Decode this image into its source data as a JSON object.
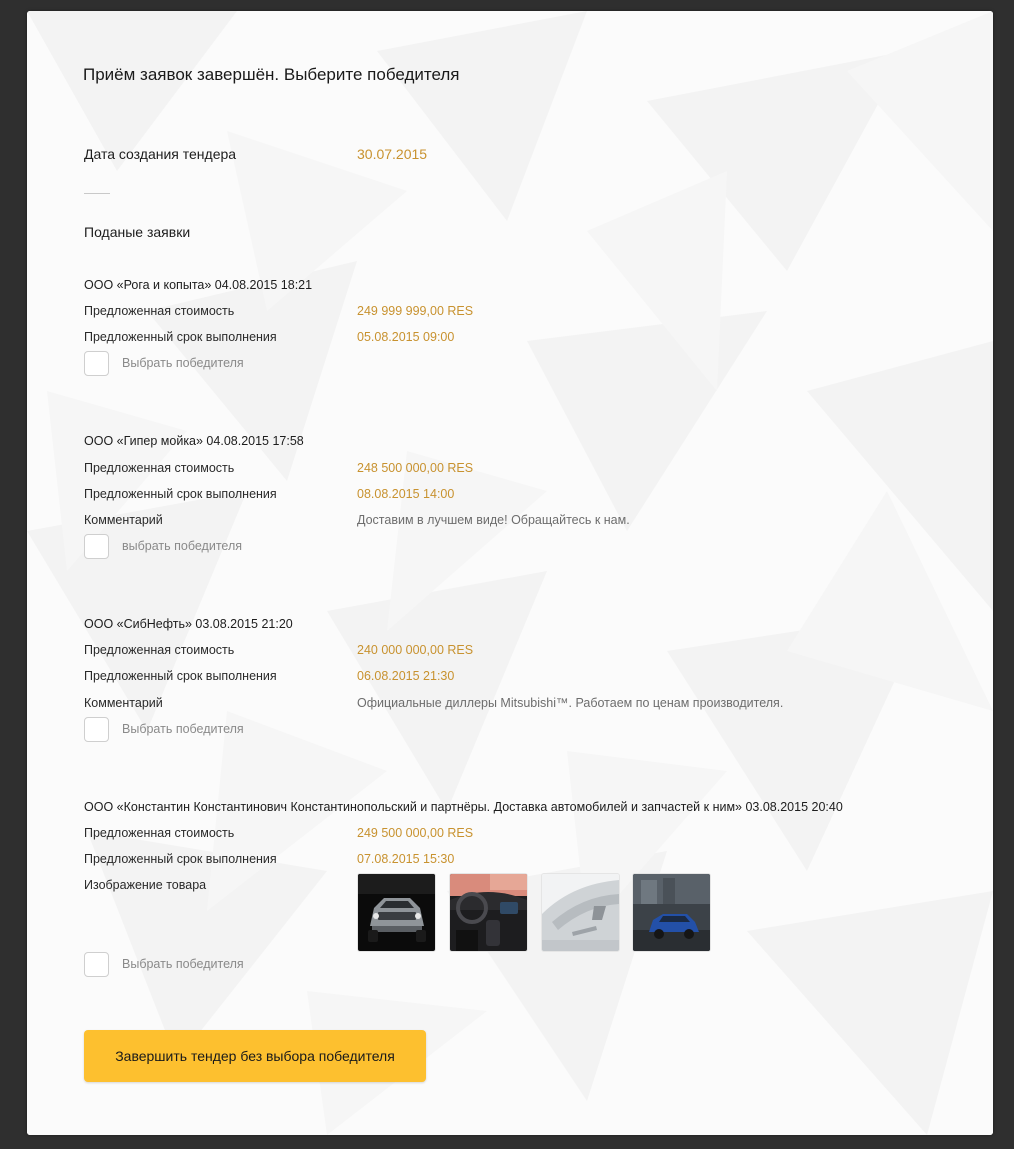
{
  "page_title": "Приём заявок завершён. Выберите победителя",
  "tender": {
    "created_label": "Дата создания тендера",
    "created_value": "30.07.2015"
  },
  "bids_section_title": "Поданые заявки",
  "bids": [
    {
      "header": "ООО «Рога и копыта» 04.08.2015 18:21",
      "price_label": "Предложенная стоимость",
      "price_value": "249 999 999,00 RES",
      "deadline_label": "Предложенный срок выполнения",
      "deadline_value": "05.08.2015 09:00",
      "select_label": "Выбрать победителя"
    },
    {
      "header": "ООО «Гипер мойка» 04.08.2015 17:58",
      "price_label": "Предложенная стоимость",
      "price_value": "248 500 000,00 RES",
      "deadline_label": "Предложенный срок выполнения",
      "deadline_value": "08.08.2015 14:00",
      "comment_label": "Комментарий",
      "comment_value": "Доставим в лучшем виде! Обращайтесь к нам.",
      "select_label": "выбрать победителя"
    },
    {
      "header": "ООО «СибНефть» 03.08.2015 21:20",
      "price_label": "Предложенная стоимость",
      "price_value": "240 000 000,00 RES",
      "deadline_label": "Предложенный срок выполнения",
      "deadline_value": "06.08.2015 21:30",
      "comment_label": "Комментарий",
      "comment_value": "Официальные диллеры Mitsubishi™. Работаем по ценам производителя.",
      "select_label": "Выбрать победителя"
    },
    {
      "header": "ООО «Константин Константинович Константинопольский и партнёры. Доставка автомобилей и запчастей к ним» 03.08.2015 20:40",
      "price_label": "Предложенная стоимость",
      "price_value": "249 500 000,00 RES",
      "deadline_label": "Предложенный срок выполнения",
      "deadline_value": "07.08.2015 15:30",
      "images_label": "Изображение товара",
      "select_label": "Выбрать победителя"
    }
  ],
  "finish_button_label": "Завершить тендер без выбора победителя",
  "colors": {
    "accent_text": "#c8922f",
    "button": "#fdc02f",
    "page_background": "#2f2f2f",
    "panel_background": "#fbfbfb"
  }
}
